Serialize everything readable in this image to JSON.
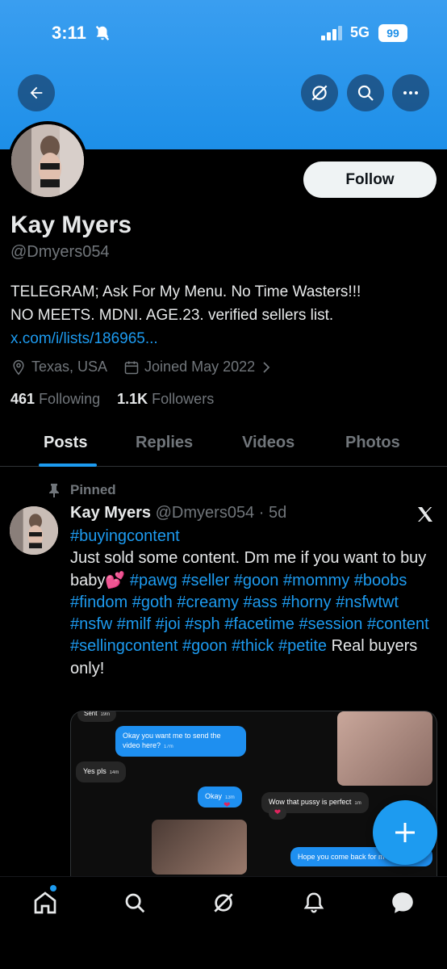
{
  "status_bar": {
    "time": "3:11",
    "network": "5G",
    "battery": "99"
  },
  "colors": {
    "accent": "#1d9bf0",
    "banner": "#1d8fe8",
    "background": "#000000",
    "muted": "#71767b"
  },
  "header": {
    "icons": [
      "back-arrow-icon",
      "grok-icon",
      "search-icon",
      "more-icon"
    ]
  },
  "profile": {
    "name": "Kay Myers",
    "handle": "@Dmyers054",
    "follow_label": "Follow",
    "bio_line1": "TELEGRAM; Ask For My Menu. No Time Wasters!!!",
    "bio_line2": "NO MEETS. MDNI. AGE.23. verified sellers list.",
    "bio_link": "x.com/i/lists/186965...",
    "location": "Texas, USA",
    "joined": "Joined May 2022",
    "following_count": "461",
    "following_label": "Following",
    "followers_count": "1.1K",
    "followers_label": "Followers"
  },
  "tabs": [
    {
      "label": "Posts",
      "active": true
    },
    {
      "label": "Replies",
      "active": false
    },
    {
      "label": "Videos",
      "active": false
    },
    {
      "label": "Photos",
      "active": false
    }
  ],
  "post": {
    "pinned_label": "Pinned",
    "author": "Kay Myers",
    "handle": "@Dmyers054",
    "time": "· 5d",
    "tag_first": "#buyingcontent",
    "text_lead": "Just sold some content. Dm me if you want to buy baby💕",
    "tags_a": "#pawg #seller #goon #mommy #boobs #findom #goth #creamy #ass #horny #nsfwtwt #nsfw #milf #joi #sph #facetime #session #content #sellingcontent #goon #thick #petite",
    "text_tail": "Real buyers only!",
    "media": {
      "msg1": "Okay you want me to send the video here?",
      "msg1_time": "17m",
      "msg2": "Yes pls",
      "msg2_time": "14m",
      "msg3": "Okay",
      "msg3_time": "13m",
      "msg4": "Wow that pussy is perfect",
      "msg4_time": "1m",
      "msg5": "Hope you come back for m",
      "msg0": "Sent",
      "msg0_time": "19m"
    }
  },
  "bottom_nav": [
    "home-icon",
    "search-icon",
    "grok-icon",
    "notifications-icon",
    "messages-icon"
  ]
}
